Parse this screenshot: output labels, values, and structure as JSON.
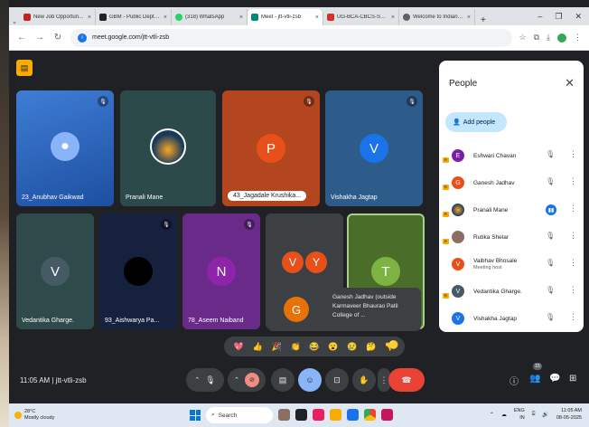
{
  "browser": {
    "tabs": [
      {
        "label": "New Job Opportun...",
        "color": "#c5221f"
      },
      {
        "label": "GBM - Public Dept-1...",
        "color": "#202124"
      },
      {
        "label": "(318) WhatsApp",
        "color": "#25d366"
      },
      {
        "label": "Meet - jtt-vtli-zsb",
        "color": "#00897b",
        "active": true
      },
      {
        "label": "UG-BCA-CBCS-SYL...",
        "color": "#d93025"
      },
      {
        "label": "Welcome to Indian R...",
        "color": "#5f6368"
      }
    ],
    "new_tab": "+",
    "url": "meet.google.com/jtt-vtli-zsb"
  },
  "meet": {
    "tiles": [
      {
        "name": "23_Anubhav Gaikwad",
        "color": "#2a6acb",
        "avatar_type": "person-icon"
      },
      {
        "name": "Pranali Mane",
        "color": "#2d4a4a",
        "avatar_type": "photo"
      },
      {
        "name": "43_Jagadale Krushika...",
        "color": "#b3461e",
        "initial": "P",
        "avatar_color": "#e8501a"
      },
      {
        "name": "Vishakha Jagtap",
        "color": "#2e5c8a",
        "initial": "V",
        "avatar_color": "#1a73e8"
      },
      {
        "name": "Vedantika Gharge.",
        "color": "#2f4a4a",
        "initial": "V",
        "avatar_color": "#455a64"
      },
      {
        "name": "93_Aishwarya Pa...",
        "color": "#16213e",
        "avatar_type": "photo"
      },
      {
        "name": "78_Aseem Naiband",
        "color": "#6a2a8a",
        "initial": "N",
        "avatar_color": "#8e24aa"
      },
      {
        "name": "",
        "color": "#3c4043",
        "initials": [
          "V",
          "Y"
        ],
        "avatar_color": "#e8501a"
      },
      {
        "name": "",
        "color": "#4a6e2a",
        "initial": "T",
        "avatar_color": "#7cb342"
      }
    ],
    "people_panel": {
      "title": "People",
      "add_people": "Add people",
      "participants": [
        {
          "name": "Eshwari Chavan",
          "sub": "",
          "initial": "E",
          "color": "#7b1fa2",
          "mic": "muted"
        },
        {
          "name": "Ganesh Jadhav",
          "sub": "",
          "initial": "G",
          "color": "#e8501a",
          "mic": "muted"
        },
        {
          "name": "Pranali Mane",
          "sub": "",
          "initial": "",
          "color": "#2d4a4a",
          "mic": "speaking"
        },
        {
          "name": "Rutika Shelar",
          "sub": "",
          "initial": "",
          "color": "#8d6e63",
          "mic": "muted"
        },
        {
          "name": "Vaibhav Bhosale",
          "sub": "Meeting host",
          "initial": "V",
          "color": "#e8501a",
          "mic": "muted"
        },
        {
          "name": "Vedantika Gharge.",
          "sub": "",
          "initial": "V",
          "color": "#455a64",
          "mic": "muted"
        },
        {
          "name": "Vishakha Jagtap",
          "sub": "",
          "initial": "V",
          "color": "#1a73e8",
          "mic": "muted"
        }
      ]
    },
    "notification": {
      "initial": "G",
      "text": "Ganesh Jadhav (outside Karmaveer Bhaurao Patil College of ..."
    },
    "reactions": [
      "💖",
      "👍",
      "🎉",
      "👏",
      "😂",
      "😮",
      "😢",
      "🤔",
      "👎"
    ],
    "reaction_extra": "🟡",
    "time": "11:05 AM",
    "meeting_code": "jtt-vtli-zsb",
    "participant_count": "15"
  },
  "taskbar": {
    "weather_temp": "28°C",
    "weather_text": "Mostly cloudy",
    "search": "Search",
    "lang": "ENG",
    "lang2": "IN",
    "clock_time": "11:05 AM",
    "clock_date": "08-05-2025"
  }
}
